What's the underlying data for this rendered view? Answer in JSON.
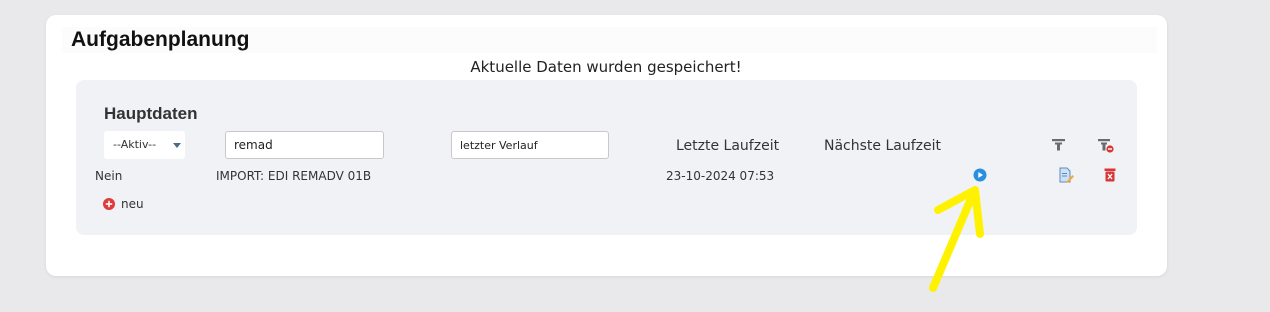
{
  "page": {
    "title": "Aufgabenplanung",
    "notice": "Aktuelle Daten wurden gespeichert!"
  },
  "section": {
    "title": "Hauptdaten"
  },
  "filters": {
    "active_select": "--Aktiv--",
    "name_value": "remad",
    "last_run_value": "letzter Verlauf"
  },
  "columns": {
    "last_runtime": "Letzte Laufzeit",
    "next_runtime": "Nächste Laufzeit"
  },
  "rows": [
    {
      "active": "Nein",
      "name": "IMPORT: EDI REMADV 01B",
      "last_runtime": "23-10-2024 07:53",
      "next_runtime": ""
    }
  ],
  "actions": {
    "new_label": "neu"
  },
  "icons": {
    "filter": "filter-icon",
    "clear_filter": "clear-filter-icon",
    "run": "play-icon",
    "edit": "edit-icon",
    "delete": "delete-icon",
    "add": "plus-circle-icon"
  },
  "colors": {
    "run_blue": "#2a8fe0",
    "delete_red": "#d93636",
    "add_red": "#e03a3a",
    "annotation_yellow": "#fff200"
  }
}
